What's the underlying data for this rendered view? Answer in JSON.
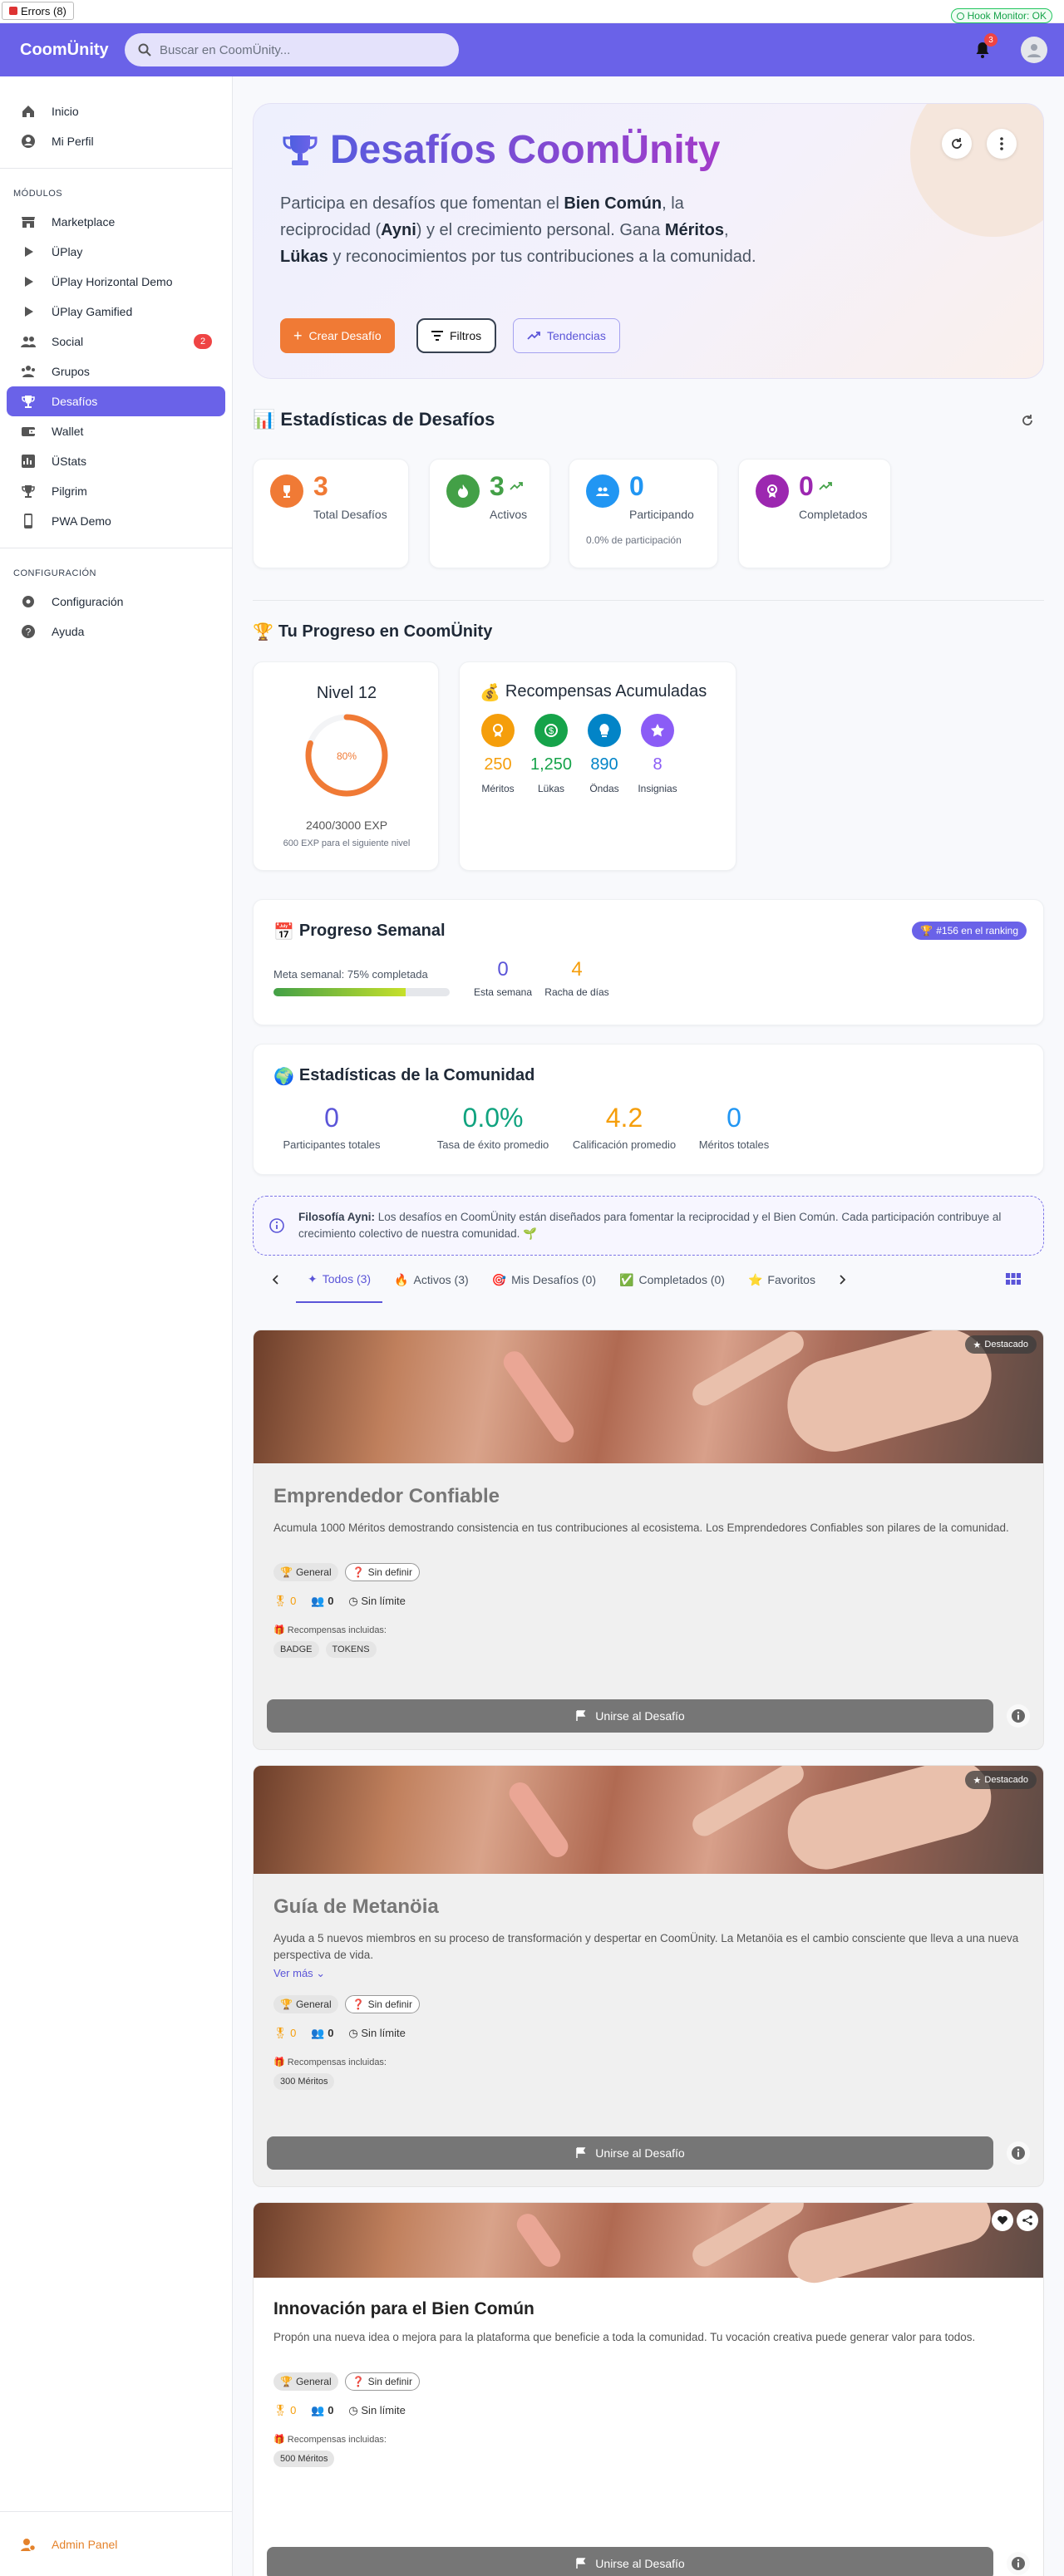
{
  "debug": {
    "errors": "Errors (8)",
    "hook": "Hook Monitor: OK"
  },
  "appbar": {
    "brand": "CoomÜnity",
    "search_placeholder": "Buscar en CoomÜnity...",
    "notif_count": "3"
  },
  "sidebar": {
    "top": [
      {
        "label": "Inicio",
        "icon": "home-icon"
      },
      {
        "label": "Mi Perfil",
        "icon": "user-circle-icon"
      }
    ],
    "modules_head": "MÓDULOS",
    "modules": [
      {
        "label": "Marketplace",
        "icon": "store-icon"
      },
      {
        "label": "ÜPlay",
        "icon": "play-icon"
      },
      {
        "label": "ÜPlay Horizontal Demo",
        "icon": "play-icon"
      },
      {
        "label": "ÜPlay Gamified",
        "icon": "play-icon"
      },
      {
        "label": "Social",
        "icon": "people-icon",
        "count": "2"
      },
      {
        "label": "Grupos",
        "icon": "groups-icon"
      },
      {
        "label": "Desafíos",
        "icon": "trophy-icon",
        "active": true
      },
      {
        "label": "Wallet",
        "icon": "wallet-icon"
      },
      {
        "label": "ÜStats",
        "icon": "stats-icon"
      },
      {
        "label": "Pilgrim",
        "icon": "trophy-icon"
      },
      {
        "label": "PWA Demo",
        "icon": "phone-icon"
      }
    ],
    "config_head": "CONFIGURACIÓN",
    "config": [
      {
        "label": "Configuración",
        "icon": "gear-icon"
      },
      {
        "label": "Ayuda",
        "icon": "help-icon"
      }
    ],
    "admin": "Admin Panel"
  },
  "hero": {
    "title": "Desafíos CoomÜnity",
    "desc_1": "Participa en desafíos que fomentan el ",
    "desc_b1": "Bien Común",
    "desc_2": ", la reciprocidad (",
    "desc_b2": "Ayni",
    "desc_3": ") y el crecimiento personal. Gana ",
    "desc_b3": "Méritos",
    "desc_4": ", ",
    "desc_b4": "Lükas",
    "desc_5": " y reconocimientos por tus contribuciones a la comunidad.",
    "btn_create": "Crear Desafío",
    "btn_filters": "Filtros",
    "btn_trends": "Tendencias"
  },
  "stats": {
    "title": "Estadísticas de Desafíos",
    "items": [
      {
        "value": "3",
        "label": "Total Desafíos",
        "color": "#f07a35",
        "sub": ""
      },
      {
        "value": "3",
        "label": "Activos",
        "color": "#43a047",
        "sub": ""
      },
      {
        "value": "0",
        "label": "Participando",
        "color": "#2196f3",
        "sub": "0.0% de participación"
      },
      {
        "value": "0",
        "label": "Completados",
        "color": "#9c27b0",
        "sub": ""
      }
    ]
  },
  "progress": {
    "title": "Tu Progreso en CoomÜnity",
    "level": "Nivel 12",
    "pct_label": "80%",
    "pct": 0.8,
    "exp": "2400/3000 EXP",
    "exp_next": "600 EXP para el siguiente nivel",
    "rewards_title": "Recompensas Acumuladas",
    "rewards": [
      {
        "value": "250",
        "label": "Méritos",
        "color": "#f59e0b",
        "icon": "medal-icon"
      },
      {
        "value": "1,250",
        "label": "Lükas",
        "color": "#16a34a",
        "icon": "dollar-icon"
      },
      {
        "value": "890",
        "label": "Öndas",
        "color": "#0284c7",
        "icon": "energy-icon"
      },
      {
        "value": "8",
        "label": "Insignias",
        "color": "#8b5cf6",
        "icon": "star-icon"
      }
    ]
  },
  "weekly": {
    "title": "Progreso Semanal",
    "ranking": "#156 en el ranking",
    "meta": "Meta semanal: 75% completada",
    "meta_pct": 0.75,
    "this_week": "0",
    "this_week_label": "Esta semana",
    "streak": "4",
    "streak_label": "Racha de días"
  },
  "community": {
    "title": "Estadísticas de la Comunidad",
    "items": [
      {
        "value": "0",
        "label": "Participantes totales",
        "color": "#5b55d8"
      },
      {
        "value": "0.0%",
        "label": "Tasa de éxito promedio",
        "color": "#10a37f"
      },
      {
        "value": "4.2",
        "label": "Calificación promedio",
        "color": "#f59e0b"
      },
      {
        "value": "0",
        "label": "Méritos totales",
        "color": "#2196f3"
      }
    ]
  },
  "philosophy": {
    "bold": "Filosofía Ayni:",
    "text": " Los desafíos en CoomÜnity están diseñados para fomentar la reciprocidad y el Bien Común. Cada participación contribuye al crecimiento colectivo de nuestra comunidad. 🌱"
  },
  "tabs": [
    {
      "label": "Todos (3)",
      "icon": "✦"
    },
    {
      "label": "Activos (3)",
      "icon": "🔥"
    },
    {
      "label": "Mis Desafíos (0)",
      "icon": "🎯"
    },
    {
      "label": "Completados (0)",
      "icon": "✅"
    },
    {
      "label": "Favoritos",
      "icon": "⭐"
    }
  ],
  "challenges": [
    {
      "title": "Emprendedor Confiable",
      "desc": "Acumula 1000 Méritos demostrando consistencia en tus contribuciones al ecosistema. Los Emprendedores Confiables son pilares de la comunidad.",
      "featured": "Destacado",
      "cat": "General",
      "diff": "Sin definir",
      "merits": "0",
      "people": "0",
      "time": "Sin límite",
      "rewards_label": "Recompensas incluidas:",
      "rewards": [
        "BADGE",
        "TOKENS"
      ],
      "join": "Unirse al Desafío",
      "more": ""
    },
    {
      "title": "Guía de Metanöia",
      "desc": "Ayuda a 5 nuevos miembros en su proceso de transformación y despertar en CoomÜnity. La Metanöia es el cambio consciente que lleva a una nueva perspectiva de vida.",
      "featured": "Destacado",
      "cat": "General",
      "diff": "Sin definir",
      "merits": "0",
      "people": "0",
      "time": "Sin límite",
      "rewards_label": "Recompensas incluidas:",
      "rewards": [
        "300 Méritos"
      ],
      "join": "Unirse al Desafío",
      "more": "Ver más"
    },
    {
      "title": "Innovación para el Bien Común",
      "desc": "Propón una nueva idea o mejora para la plataforma que beneficie a toda la comunidad. Tu vocación creativa puede generar valor para todos.",
      "featured": "",
      "cat": "General",
      "diff": "Sin definir",
      "merits": "0",
      "people": "0",
      "time": "Sin límite",
      "rewards_label": "Recompensas incluidas:",
      "rewards": [
        "500 Méritos"
      ],
      "join": "Unirse al Desafío",
      "more": ""
    }
  ]
}
